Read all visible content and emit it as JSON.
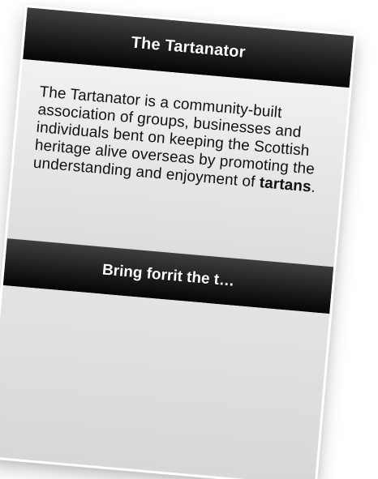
{
  "app": {
    "title": "The Tartanator"
  },
  "content": {
    "description_prefix": "The Tartanator is a community-built association of groups, businesses and individuals bent on keeping the Scottish heritage alive overseas by promoting the understanding and enjoyment of ",
    "description_emphasis": "tartans",
    "description_suffix": "."
  },
  "actions": {
    "primary_label": "Bring forrit the t…"
  },
  "colors": {
    "header_background": "#1c1c1c",
    "content_background": "#e8e8e8",
    "text": "#111111",
    "bar_text": "#ffffff"
  }
}
